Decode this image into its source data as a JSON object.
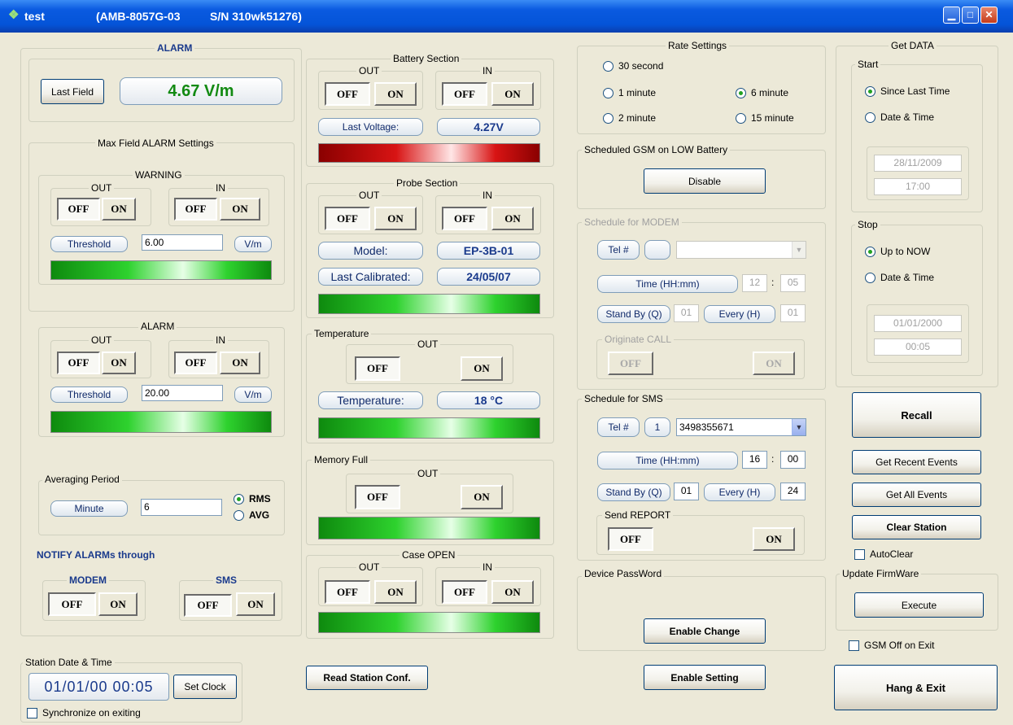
{
  "title": {
    "name": "test",
    "model": "(AMB-8057G-03",
    "serial": "S/N 310wk51276)"
  },
  "alarm": {
    "label": "ALARM",
    "last_field_button": "Last Field",
    "last_field_value": "4.67 V/m",
    "max_field": {
      "label": "Max Field ALARM Settings",
      "warning": {
        "label": "WARNING",
        "threshold_button": "Threshold",
        "threshold_value": "6.00",
        "unit": "V/m"
      },
      "alarm": {
        "label": "ALARM",
        "threshold_button": "Threshold",
        "threshold_value": "20.00",
        "unit": "V/m"
      }
    },
    "averaging": {
      "label": "Averaging Period",
      "minute_button": "Minute",
      "minute_value": "6",
      "rms": "RMS",
      "avg": "AVG",
      "selected": "RMS"
    },
    "notify": {
      "label": "NOTIFY ALARMs through",
      "modem": "MODEM",
      "sms": "SMS"
    }
  },
  "common": {
    "out": "OUT",
    "in": "IN",
    "off": "OFF",
    "on": "ON"
  },
  "battery": {
    "label": "Battery Section",
    "last_voltage_label": "Last Voltage:",
    "last_voltage_value": "4.27V"
  },
  "probe": {
    "label": "Probe Section",
    "model_label": "Model:",
    "model_value": "EP-3B-01",
    "calibrated_label": "Last Calibrated:",
    "calibrated_value": "24/05/07"
  },
  "temperature": {
    "label": "Temperature",
    "temp_label": "Temperature:",
    "temp_value": "18 °C"
  },
  "memory": {
    "label": "Memory Full"
  },
  "case_open": {
    "label": "Case OPEN"
  },
  "read_conf_button": "Read Station Conf.",
  "station_time": {
    "label": "Station Date & Time",
    "value": "01/01/00  00:05",
    "set_clock_button": "Set Clock",
    "sync_label": "Synchronize on exiting"
  },
  "rate": {
    "label": "Rate Settings",
    "options": [
      "30 second",
      "1 minute",
      "6 minute",
      "2 minute",
      "15 minute"
    ],
    "selected": "6 minute"
  },
  "gsm_low": {
    "label": "Scheduled GSM on LOW Battery",
    "button": "Disable"
  },
  "sched_modem": {
    "label": "Schedule for MODEM",
    "tel_button": "Tel #",
    "time_button": "Time (HH:mm)",
    "hh": "12",
    "mm": "05",
    "standby_button": "Stand By (Q)",
    "standby_value": "01",
    "every_button": "Every (H)",
    "every_value": "01",
    "originate_label": "Originate CALL"
  },
  "sched_sms": {
    "label": "Schedule for SMS",
    "tel_button": "Tel #",
    "tel_index": "1",
    "tel_number": "3498355671",
    "time_button": "Time (HH:mm)",
    "hh": "16",
    "mm": "00",
    "standby_button": "Stand By (Q)",
    "standby_value": "01",
    "every_button": "Every (H)",
    "every_value": "24",
    "report_label": "Send REPORT"
  },
  "password": {
    "label": "Device PassWord",
    "enable_change_button": "Enable Change"
  },
  "enable_setting_button": "Enable Setting",
  "get_data": {
    "label": "Get DATA",
    "start": {
      "label": "Start",
      "since_last": "Since Last Time",
      "date_time": "Date & Time",
      "date": "28/11/2009",
      "time": "17:00"
    },
    "stop": {
      "label": "Stop",
      "up_to_now": "Up to NOW",
      "date_time": "Date & Time",
      "date": "01/01/2000",
      "time": "00:05"
    }
  },
  "recall_button": "Recall",
  "recent_events_button": "Get Recent Events",
  "all_events_button": "Get All Events",
  "clear_station_button": "Clear Station",
  "autoclear_label": "AutoClear",
  "firmware": {
    "label": "Update FirmWare",
    "execute_button": "Execute"
  },
  "gsm_off_label": "GSM Off on Exit",
  "hang_exit_button": "Hang & Exit",
  "colors": {
    "titlebar": "#0454d8",
    "value_blue": "#1a3a8c",
    "field_green": "#128a12"
  }
}
